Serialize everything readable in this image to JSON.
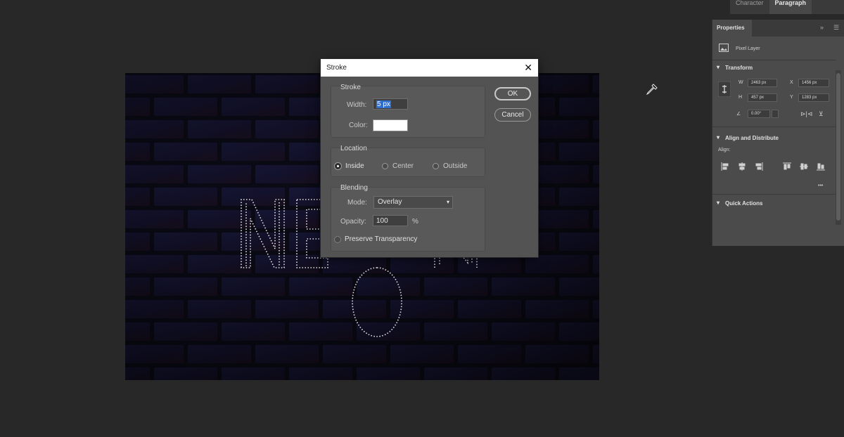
{
  "top_panel": {
    "tabs": [
      "Character",
      "Paragraph"
    ],
    "active_tab": "Paragraph"
  },
  "canvas": {
    "text": "NEON"
  },
  "stroke_dialog": {
    "title": "Stroke",
    "close_icon": "close-icon",
    "stroke_group": {
      "label": "Stroke",
      "width_label": "Width:",
      "width_value": "5 px",
      "color_label": "Color:",
      "color_value": "#ffffff"
    },
    "location_group": {
      "label": "Location",
      "options": [
        "Inside",
        "Center",
        "Outside"
      ],
      "selected": "Inside"
    },
    "blending_group": {
      "label": "Blending",
      "mode_label": "Mode:",
      "mode_value": "Overlay",
      "opacity_label": "Opacity:",
      "opacity_value": "100",
      "opacity_unit": "%",
      "preserve_label": "Preserve Transparency"
    },
    "ok_label": "OK",
    "cancel_label": "Cancel"
  },
  "properties_panel": {
    "tab": "Properties",
    "layer_type": "Pixel Layer",
    "transform": {
      "label": "Transform",
      "w_label": "W",
      "w_value": "2463 px",
      "x_label": "X",
      "x_value": "1456 px",
      "h_label": "H",
      "h_value": "457 px",
      "y_label": "Y",
      "y_value": "1283 px",
      "angle_value": "0.00°"
    },
    "align": {
      "label": "Align and Distribute",
      "sub_label": "Align:"
    },
    "quick_actions": {
      "label": "Quick Actions"
    },
    "more_label": "•••"
  }
}
